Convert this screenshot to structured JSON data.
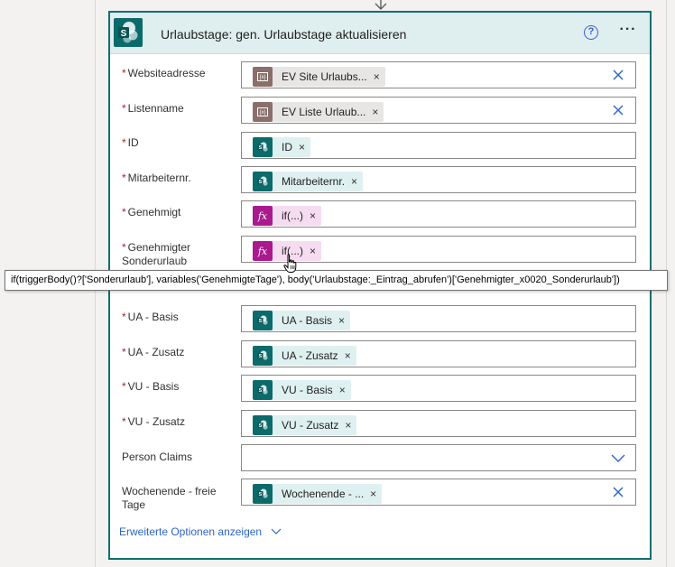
{
  "card": {
    "title": "Urlaubstage: gen. Urlaubstage aktualisieren",
    "help_icon": "question-circle-icon",
    "more_icon": "ellipsis-icon",
    "more_label": "···",
    "help_label": "?"
  },
  "fields": [
    {
      "label": "Websiteadresse",
      "required": true,
      "token": {
        "kind": "variable",
        "text": "EV Site Urlaubs..."
      },
      "action": "clear"
    },
    {
      "label": "Listenname",
      "required": true,
      "token": {
        "kind": "variable",
        "text": "EV Liste Urlaub..."
      },
      "action": "clear"
    },
    {
      "label": "ID",
      "required": true,
      "token": {
        "kind": "sharepoint",
        "text": "ID"
      }
    },
    {
      "label": "Mitarbeiternr.",
      "required": true,
      "token": {
        "kind": "sharepoint",
        "text": "Mitarbeiternr."
      }
    },
    {
      "label": "Genehmigt",
      "required": true,
      "token": {
        "kind": "expression",
        "text": "if(...)"
      }
    },
    {
      "label": "Genehmigter Sonderurlaub",
      "required": true,
      "token": {
        "kind": "expression",
        "text": "if(...)"
      }
    },
    {
      "label": "UA - Basis",
      "required": true,
      "token": {
        "kind": "sharepoint",
        "text": "UA - Basis"
      }
    },
    {
      "label": "UA - Zusatz",
      "required": true,
      "token": {
        "kind": "sharepoint",
        "text": "UA - Zusatz"
      }
    },
    {
      "label": "VU - Basis",
      "required": true,
      "token": {
        "kind": "sharepoint",
        "text": "VU - Basis"
      }
    },
    {
      "label": "VU - Zusatz",
      "required": true,
      "token": {
        "kind": "sharepoint",
        "text": "VU - Zusatz"
      }
    },
    {
      "label": "Person Claims",
      "required": false,
      "value": "",
      "action": "dropdown"
    },
    {
      "label": "Wochenende - freie Tage",
      "required": false,
      "token": {
        "kind": "sharepoint",
        "text": "Wochenende - ..."
      },
      "action": "clear"
    }
  ],
  "required_marker": "*",
  "token_remove_glyph": "×",
  "fx_glyph": "fx",
  "tooltip": {
    "text": "if(triggerBody()?['Sonderurlaub'], variables('GenehmigteTage'), body('Urlaubstage:_Eintrag_abrufen')['Genehmigter_x0020_Sonderurlaub'])"
  },
  "advanced_options": {
    "label": "Erweiterte Optionen anzeigen"
  },
  "colors": {
    "sharepoint_teal": "#0b6a6a",
    "expression_magenta": "#aa1a8e",
    "variable_mauve": "#8b6f6a",
    "link_blue": "#2b65c4",
    "required_red": "#a4262c"
  }
}
